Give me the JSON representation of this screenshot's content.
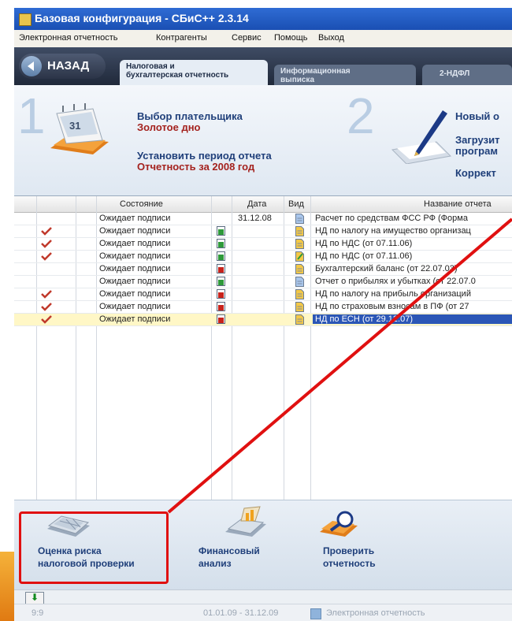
{
  "window": {
    "title": "Базовая конфигурация - СБиС++ 2.3.14"
  },
  "menu": [
    "Электронная отчетность",
    "Контрагенты",
    "Сервис",
    "Помощь",
    "Выход"
  ],
  "nav": {
    "back_label": "НАЗАД",
    "tabs": [
      {
        "line1": "Налоговая и",
        "line2": "бухгалтерская отчетность",
        "active": true
      },
      {
        "line1": "Информационная",
        "line2": "выписка",
        "active": false
      },
      {
        "line1": "2-НДФЛ",
        "line2": "",
        "active": false
      }
    ]
  },
  "header": {
    "step1_number": "1",
    "payer_label": "Выбор плательщика",
    "payer_value": "Золотое дно",
    "period_label": "Установить период отчета",
    "period_value": "Отчетность за 2008 год",
    "calendar_day": "31",
    "step2_number": "2",
    "step2_line1": "Новый о",
    "step2_line2": "Загрузит",
    "step2_line3": "програм",
    "step2_line4": "Коррект"
  },
  "grid": {
    "columns": {
      "state": "Состояние",
      "date": "Дата",
      "kind": "Вид",
      "name": "Название отчета"
    },
    "rows": [
      {
        "checked": false,
        "state": "Ожидает подписи",
        "date": "31.12.08",
        "sig": "none",
        "doc": "blue",
        "name": "Расчет по средствам ФСС РФ (Форма"
      },
      {
        "checked": true,
        "state": "Ожидает подписи",
        "date": "",
        "sig": "green",
        "doc": "yellow",
        "name": "НД по налогу на имущество организац"
      },
      {
        "checked": true,
        "state": "Ожидает подписи",
        "date": "",
        "sig": "green",
        "doc": "yellow",
        "name": "НД по НДС (от 07.11.06)"
      },
      {
        "checked": true,
        "state": "Ожидает подписи",
        "date": "",
        "sig": "green",
        "doc": "edit",
        "name": "НД по НДС (от 07.11.06)"
      },
      {
        "checked": false,
        "state": "Ожидает подписи",
        "date": "",
        "sig": "red",
        "doc": "yellow",
        "name": "Бухгалтерский баланс (от 22.07.03)"
      },
      {
        "checked": false,
        "state": "Ожидает подписи",
        "date": "",
        "sig": "green",
        "doc": "blue",
        "name": "Отчет о прибылях и убытках (от 22.07.0"
      },
      {
        "checked": true,
        "state": "Ожидает подписи",
        "date": "",
        "sig": "red",
        "doc": "yellow",
        "name": "НД по налогу на прибыль организаций"
      },
      {
        "checked": true,
        "state": "Ожидает подписи",
        "date": "",
        "sig": "red",
        "doc": "yellow",
        "name": "НД по страховым взносам в ПФ (от 27"
      },
      {
        "checked": true,
        "state": "Ожидает подписи",
        "date": "",
        "sig": "red",
        "doc": "yellow",
        "name": "НД по ЕСН (от 29.12.07)",
        "selected": true
      }
    ]
  },
  "actions": {
    "risk": {
      "line1": "Оценка риска",
      "line2": "налоговой проверки"
    },
    "finance": {
      "line1": "Финансовый",
      "line2": "анализ"
    },
    "check": {
      "line1": "Проверить",
      "line2": "отчетность"
    }
  },
  "status": {
    "left": "9:9",
    "period": "01.01.09 - 31.12.09",
    "module": "Электронная отчетность"
  },
  "colors": {
    "title_bar": "#1a4fb3",
    "accent_red": "#e01010",
    "selected_row": "#2b56b6",
    "header_red": "#a4221e"
  }
}
